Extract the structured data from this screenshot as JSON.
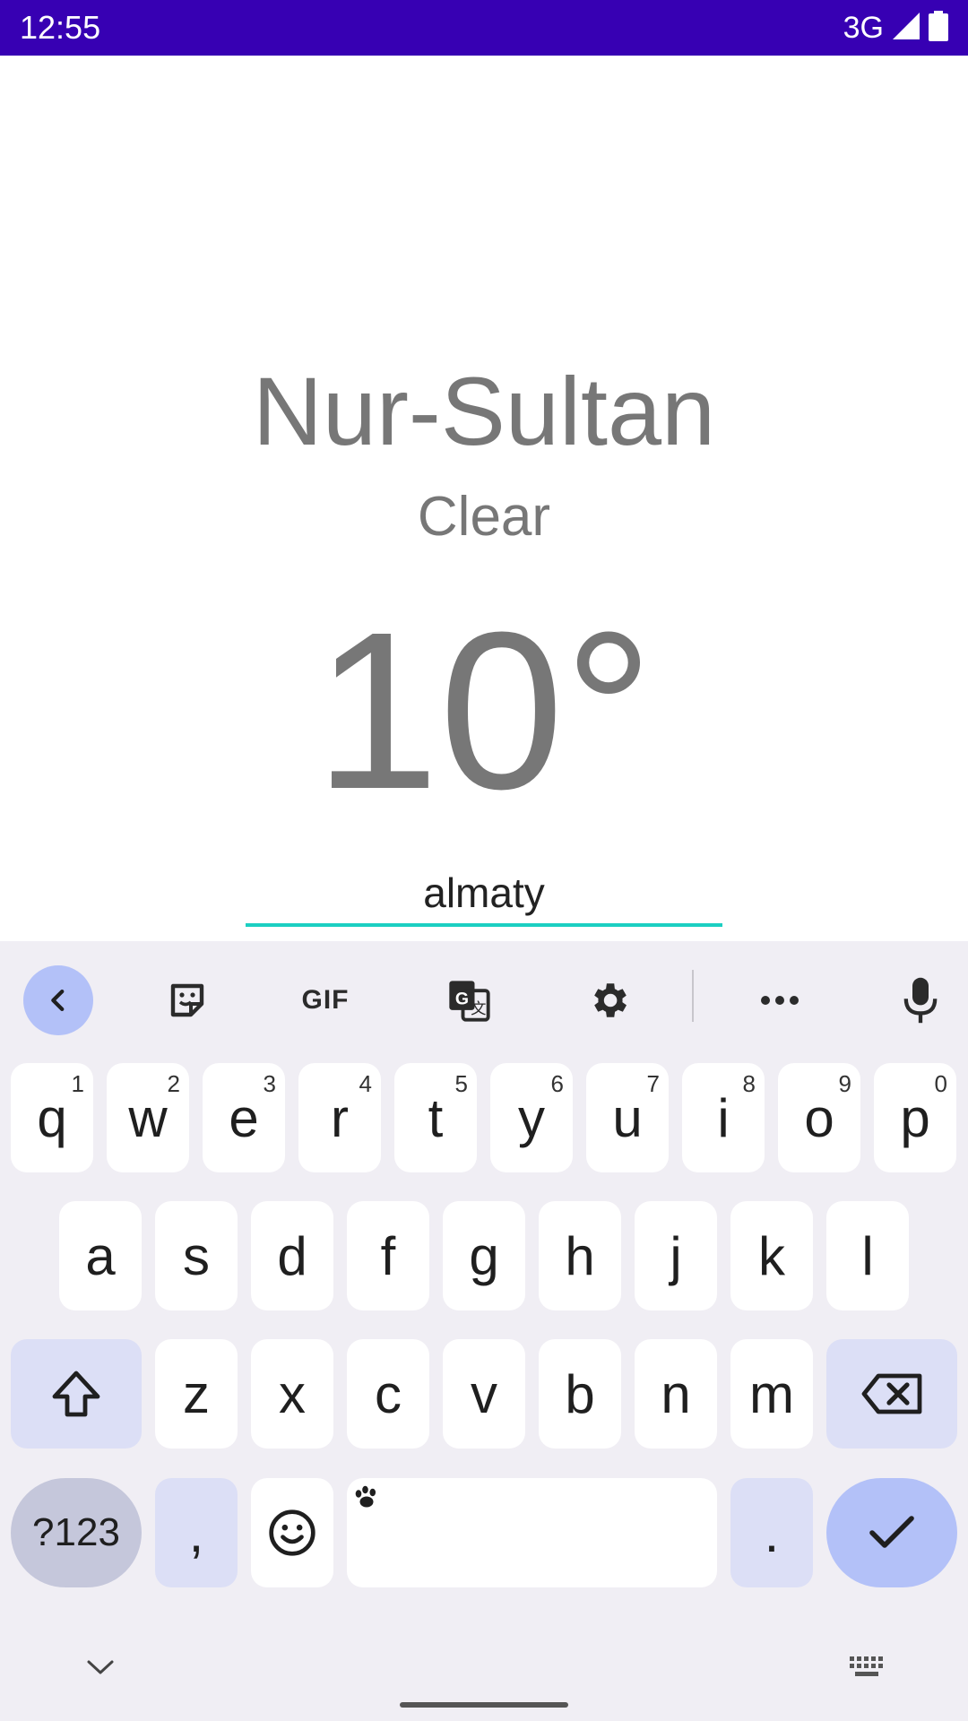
{
  "status_bar": {
    "time": "12:55",
    "network": "3G",
    "bg_color": "#3700B3"
  },
  "weather": {
    "city": "Nur-Sultan",
    "condition": "Clear",
    "temperature": "10°"
  },
  "search": {
    "value": "almaty",
    "underline_color": "#1ccfc2"
  },
  "keyboard": {
    "toolbar": {
      "back_icon": "chevron-left-icon",
      "sticker_icon": "sticker-icon",
      "gif_label": "GIF",
      "translate_icon": "translate-icon",
      "settings_icon": "gear-icon",
      "more_icon": "more-horizontal-icon",
      "mic_icon": "microphone-icon"
    },
    "row1": [
      {
        "label": "q",
        "hint": "1"
      },
      {
        "label": "w",
        "hint": "2"
      },
      {
        "label": "e",
        "hint": "3"
      },
      {
        "label": "r",
        "hint": "4"
      },
      {
        "label": "t",
        "hint": "5"
      },
      {
        "label": "y",
        "hint": "6"
      },
      {
        "label": "u",
        "hint": "7"
      },
      {
        "label": "i",
        "hint": "8"
      },
      {
        "label": "o",
        "hint": "9"
      },
      {
        "label": "p",
        "hint": "0"
      }
    ],
    "row2": [
      "a",
      "s",
      "d",
      "f",
      "g",
      "h",
      "j",
      "k",
      "l"
    ],
    "row3": [
      "z",
      "x",
      "c",
      "v",
      "b",
      "n",
      "m"
    ],
    "symbols_label": "?123",
    "comma_label": ",",
    "period_label": ".",
    "accent_color": "#b3c1f8"
  }
}
